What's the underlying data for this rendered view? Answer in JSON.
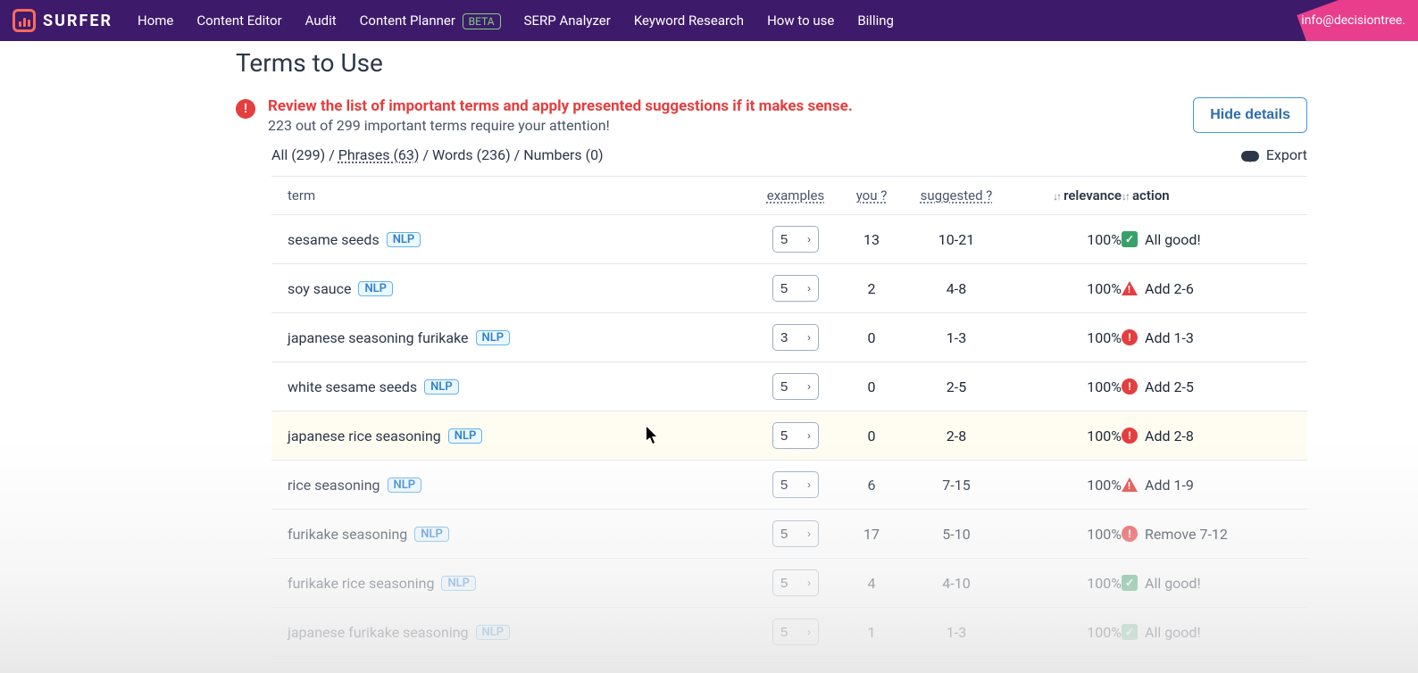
{
  "brand": "SURFER",
  "nav": {
    "home": "Home",
    "content_editor": "Content Editor",
    "audit": "Audit",
    "content_planner": "Content Planner",
    "beta": "BETA",
    "serp_analyzer": "SERP Analyzer",
    "keyword_research": "Keyword Research",
    "how_to_use": "How to use",
    "billing": "Billing"
  },
  "email": "info@decisiontree.",
  "page_title": "Terms to Use",
  "alert": {
    "title": "Review the list of important terms and apply presented suggestions if it makes sense.",
    "sub": "223 out of 299 important terms require your attention!"
  },
  "hide_details": "Hide details",
  "filters": {
    "all": "All (299)",
    "phrases": "Phrases (63)",
    "words": "Words (236)",
    "numbers": "Numbers (0)"
  },
  "export": "Export",
  "headers": {
    "term": "term",
    "examples": "examples",
    "you": "you ?",
    "suggested": "suggested ?",
    "relevance": "relevance",
    "action": "action"
  },
  "nlp_label": "NLP",
  "rows": [
    {
      "term": "sesame seeds",
      "nlp": true,
      "examples": "5",
      "you": "13",
      "suggested": "10-21",
      "relevance": "100%",
      "action_type": "check",
      "action_text": "All good!",
      "highlight": false
    },
    {
      "term": "soy sauce",
      "nlp": true,
      "examples": "5",
      "you": "2",
      "suggested": "4-8",
      "relevance": "100%",
      "action_type": "warn-tri",
      "action_text": "Add 2-6",
      "highlight": false
    },
    {
      "term": "japanese seasoning furikake",
      "nlp": true,
      "examples": "3",
      "you": "0",
      "suggested": "1-3",
      "relevance": "100%",
      "action_type": "warn-circ",
      "action_text": "Add 1-3",
      "highlight": false
    },
    {
      "term": "white sesame seeds",
      "nlp": true,
      "examples": "5",
      "you": "0",
      "suggested": "2-5",
      "relevance": "100%",
      "action_type": "warn-circ",
      "action_text": "Add 2-5",
      "highlight": false
    },
    {
      "term": "japanese rice seasoning",
      "nlp": true,
      "examples": "5",
      "you": "0",
      "suggested": "2-8",
      "relevance": "100%",
      "action_type": "warn-circ",
      "action_text": "Add 2-8",
      "highlight": true
    },
    {
      "term": "rice seasoning",
      "nlp": true,
      "examples": "5",
      "you": "6",
      "suggested": "7-15",
      "relevance": "100%",
      "action_type": "warn-tri",
      "action_text": "Add 1-9",
      "highlight": false
    },
    {
      "term": "furikake seasoning",
      "nlp": true,
      "examples": "5",
      "you": "17",
      "suggested": "5-10",
      "relevance": "100%",
      "action_type": "warn-circ",
      "action_text": "Remove 7-12",
      "highlight": false
    },
    {
      "term": "furikake rice seasoning",
      "nlp": true,
      "examples": "5",
      "you": "4",
      "suggested": "4-10",
      "relevance": "100%",
      "action_type": "check",
      "action_text": "All good!",
      "highlight": false
    },
    {
      "term": "japanese furikake seasoning",
      "nlp": true,
      "examples": "5",
      "you": "1",
      "suggested": "1-3",
      "relevance": "100%",
      "action_type": "check-dim",
      "action_text": "All good!",
      "highlight": false
    }
  ]
}
